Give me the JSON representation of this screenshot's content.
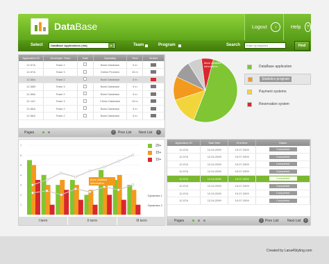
{
  "header": {
    "brand_a": "Data",
    "brand_b": "Base",
    "logout": "Logout",
    "help": "Help"
  },
  "nav": {
    "select_label": "Select",
    "select_value": "DataBase Applications (list)",
    "team": "Team",
    "program": "Program",
    "search_label": "Search",
    "search_placeholder": "Enter by keyword",
    "find": "Find"
  },
  "table1": {
    "headers": [
      "Application ID",
      "Developer Team",
      "Date",
      "Speciality",
      "Time",
      "Orders"
    ],
    "rows": [
      [
        "12-57A",
        "Team 2",
        "",
        "Bank Database",
        "3 m",
        ""
      ],
      [
        "12-57A",
        "Team 3",
        "",
        "Online Problem",
        "15 m",
        ""
      ],
      [
        "12-58A",
        "Team 2",
        "",
        "Bank Database",
        "3 m",
        ""
      ],
      [
        "12-58B",
        "Team 3",
        "",
        "Bank Database",
        "3 m",
        ""
      ],
      [
        "12-58A",
        "Team 2",
        "",
        "Bank Database",
        "3 m",
        ""
      ],
      [
        "12-14C",
        "Team 3",
        "",
        "Chinic Database",
        "15 m",
        ""
      ],
      [
        "12-58A",
        "Team 2",
        "",
        "Bank Database",
        "3 m",
        ""
      ],
      [
        "12-58A",
        "Team 2",
        "",
        "Bank Database",
        "3 m",
        ""
      ]
    ]
  },
  "pager1": {
    "label": "Pages",
    "prev": "Prev List",
    "next": "Next List"
  },
  "pie_menu": [
    "DataBase application",
    "Statistics program",
    "Payment systems",
    "Reservation system"
  ],
  "pie_callout": "More detailed information",
  "legend": [
    "20+",
    "15+",
    "10+"
  ],
  "bar_callout": "More detailed information",
  "dyn": [
    "Dynamics 1",
    "Dynamics 2"
  ],
  "bar_tabs": [
    "I term",
    "II term",
    "III term"
  ],
  "chart_data": {
    "type": "bar",
    "categories": [
      "I",
      "II",
      "III",
      "IV",
      "V",
      "VI",
      "VII",
      "VIII"
    ],
    "series": [
      {
        "name": "20+",
        "values": [
          5.5,
          4.0,
          3.0,
          3.5,
          2.0,
          4.5,
          3.5,
          3.0
        ]
      },
      {
        "name": "15+",
        "values": [
          5.0,
          3.0,
          3.5,
          3.0,
          2.5,
          3.5,
          4.0,
          2.5
        ]
      },
      {
        "name": "10+",
        "values": [
          3.5,
          1.0,
          2.5,
          1.5,
          1.0,
          2.0,
          1.5,
          1.0
        ]
      }
    ],
    "ylim": [
      0,
      7
    ],
    "ylabel_ticks": [
      "1",
      "2",
      "3",
      "4",
      "5",
      "6",
      "7"
    ]
  },
  "pie": {
    "values": [
      52,
      14,
      12,
      9,
      7,
      6
    ],
    "colors": [
      "#7fc534",
      "#f2d53a",
      "#f39a1e",
      "#9d9d9d",
      "#cfcfcf",
      "#d9272e"
    ]
  },
  "table2": {
    "headers": [
      "Application ID",
      "Start time",
      "End time",
      "Status"
    ],
    "rows": [
      [
        "12-57A",
        "12.04.2009",
        "15.07.2009",
        "Completed"
      ],
      [
        "12-57A",
        "12.04.2009",
        "15.07.2009",
        "Completed"
      ],
      [
        "12-57A",
        "12.04.2009",
        "15.07.2009",
        "Completed"
      ],
      [
        "12-57A",
        "12.04.2009",
        "15.07.2009",
        "Completed"
      ],
      [
        "12-57A",
        "12.04.2009",
        "15.07.2009",
        "Completed"
      ],
      [
        "12-57A",
        "12.04.2009",
        "15.07.2009",
        "Completed"
      ],
      [
        "12-57A",
        "12.04.2009",
        "15.07.2009",
        "Completed"
      ],
      [
        "12-57A",
        "12.04.2009",
        "15.07.2009",
        "Completed"
      ]
    ]
  },
  "pager2": {
    "label": "Pages",
    "prev": "Prev List",
    "next": "Next List"
  },
  "credit": "Created by Lana4Styling.com"
}
